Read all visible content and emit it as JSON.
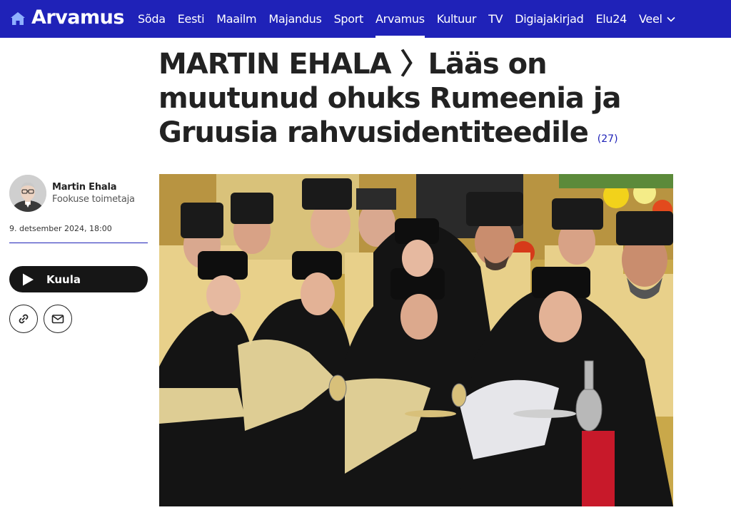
{
  "nav": {
    "logo": "Arvamus",
    "items": [
      "Sõda",
      "Eesti",
      "Maailm",
      "Majandus",
      "Sport",
      "Arvamus",
      "Kultuur",
      "TV",
      "Digiajakirjad",
      "Elu24"
    ],
    "active": "Arvamus",
    "more_label": "Veel",
    "icons": {
      "home": "home-icon",
      "more": "chevron-down-icon"
    }
  },
  "article": {
    "title": "MARTIN EHALA 〉Lääs on muutunud ohuks Rumeenia ja Gruusia rahvusidentiteedile",
    "comments_count": "(27)"
  },
  "author": {
    "name": "Martin Ehala",
    "role": "Fookuse toimetaja",
    "date": "9. detsember 2024, 18:00"
  },
  "actions": {
    "listen_label": "Kuula",
    "icons": [
      "play-icon",
      "link-icon",
      "mail-icon"
    ]
  },
  "colors": {
    "brand": "#1f22b8",
    "text": "#222222",
    "button_dark": "#161616"
  }
}
